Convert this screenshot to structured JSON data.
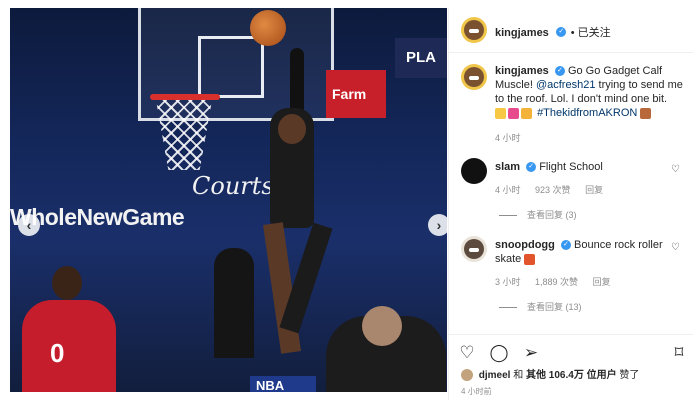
{
  "post": {
    "username": "kingjames",
    "follow_status": "已关注",
    "caption": {
      "text": "Go Go Gadget Calf Muscle!",
      "mention": "@acfresh21",
      "text2": "trying to send me to the roof. Lol. I don't mind one bit.",
      "hashtag": "#ThekidfromAKRON",
      "time": "4 小时"
    },
    "photo": {
      "signs": {
        "courts": "Courts",
        "whole": "WholeNewGame",
        "pla": "PLA",
        "farm": "Farm",
        "jersey_number": "0",
        "nba": "NBA"
      }
    }
  },
  "comments": [
    {
      "username": "slam",
      "text": "Flight School",
      "time": "4 小时",
      "likes": "923 次赞",
      "reply": "回复",
      "view_replies": "查看回复 (3)"
    },
    {
      "username": "snoopdogg",
      "text": "Bounce rock roller skate",
      "time": "3 小时",
      "likes": "1,889 次赞",
      "reply": "回复",
      "view_replies": "查看回复 (13)"
    }
  ],
  "footer": {
    "liker": "djmeel",
    "and": "和",
    "others": "其他 106.4万 位用户",
    "suffix": "赞了",
    "timestamp": "4 小时前"
  },
  "colors": {
    "verified": "#3897f0",
    "link": "#00376b",
    "muted": "#8e8e8e"
  }
}
